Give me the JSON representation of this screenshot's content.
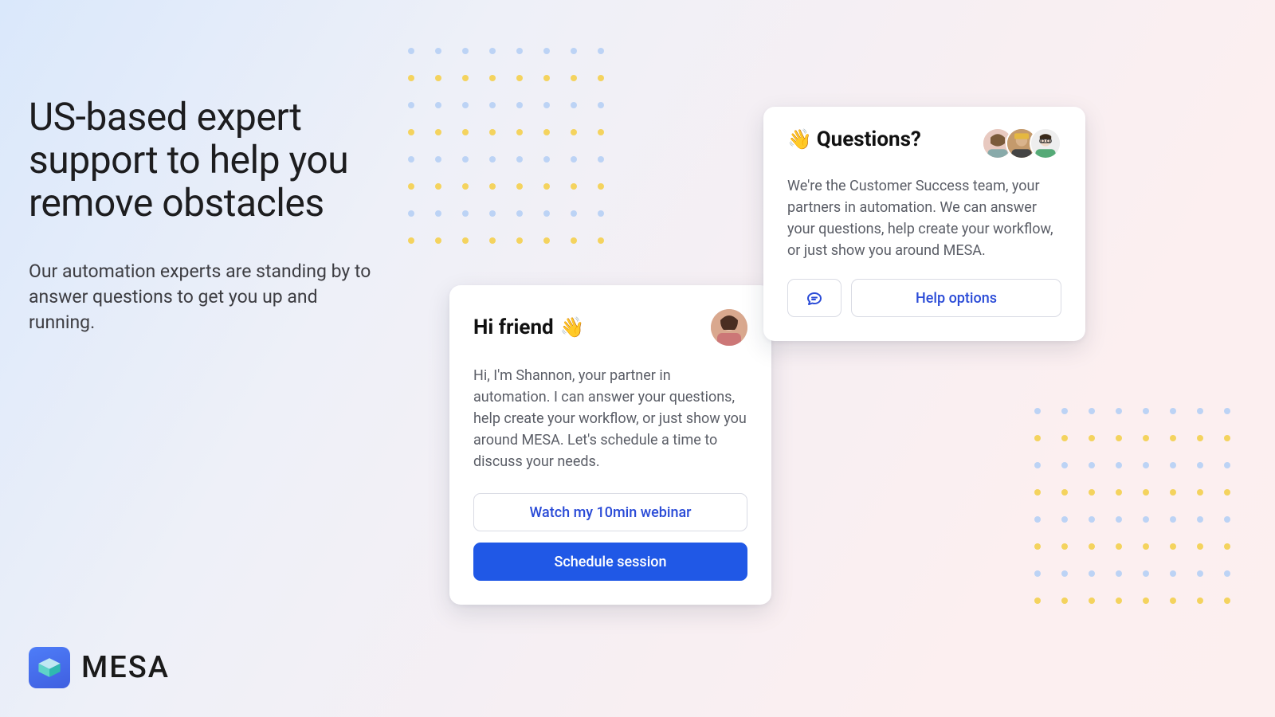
{
  "brand": {
    "name": "MESA"
  },
  "hero": {
    "title": "US-based expert support to help you remove obstacles",
    "subtitle": "Our automation experts are standing by to answer questions to get you up and running."
  },
  "friend_card": {
    "greeting": "Hi friend",
    "wave_emoji": "👋",
    "body": "Hi, I'm Shannon, your partner in automation. I can answer your questions, help create your workflow, or just show you around MESA. Let's schedule a time to discuss your needs.",
    "watch_label": "Watch my 10min webinar",
    "schedule_label": "Schedule session"
  },
  "questions_card": {
    "wave_emoji": "👋",
    "title": "Questions?",
    "body": "We're the Customer Success team, your partners in automation. We can answer your questions, help create your workflow, or just show you around MESA.",
    "help_label": "Help options"
  }
}
